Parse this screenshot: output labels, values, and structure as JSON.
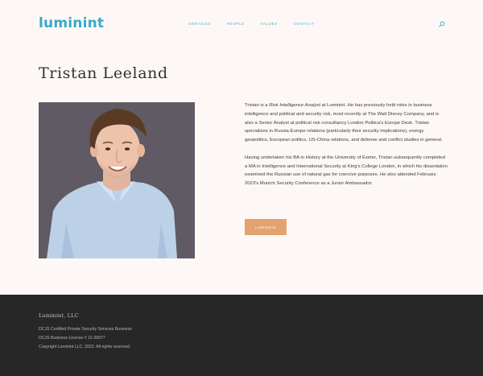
{
  "header": {
    "logo": "luminint",
    "nav": [
      "SERVICES",
      "PEOPLE",
      "VALUES",
      "CONTACT"
    ],
    "search_icon": "search-icon"
  },
  "profile": {
    "name": "Tristan Leeland",
    "bio_p1_before": "Tristan is a ",
    "bio_p1_em": "Risk Intelligence Analyst",
    "bio_p1_after": " at Luminint. He has previously held roles in business intelligence and political and security risk, most recently at The Walt Disney Company, and is also a Senior Analyst at political risk consultancy London Politica's Europe Desk. Tristan specializes in Russia-Europe relations (particularly their security implications), energy geopolitics, European politics, US-China relations, and defense and conflict studies in general.",
    "bio_p2": "Having undertaken his BA in History at the University of Exeter, Tristan subsequently completed a MA in Intelligence and International Security at King's College London, in which his dissertation examined the Russian use of natural gas for coercive purposes. He also attended February 2023's Munich Security Conference as a Junior Ambassador.",
    "linkedin_label": "LINKEDIN"
  },
  "footer": {
    "brand": "Luminint, LLC",
    "line1": "DCJS Certified Private Security Services Business",
    "line2": "DCJS Business License # 11-20077",
    "line3": "Copyright Luminint LLC, 2022.  All rights reserved."
  },
  "colors": {
    "accent": "#3aa8c9",
    "button": "#e3a26f",
    "background": "#fdf8f6",
    "footer": "#272727"
  }
}
